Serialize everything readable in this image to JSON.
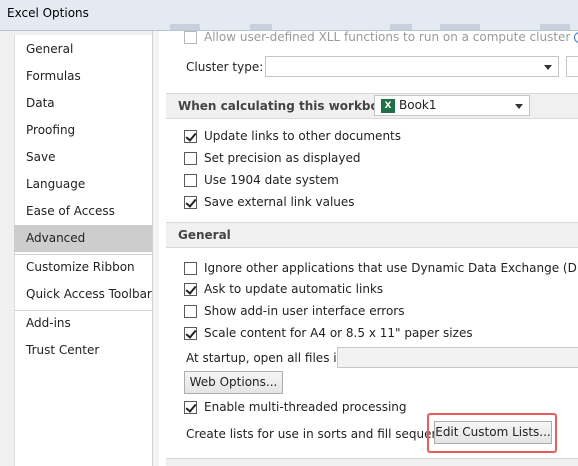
{
  "window": {
    "title": "Excel Options"
  },
  "nav": {
    "items": [
      {
        "label": "General"
      },
      {
        "label": "Formulas"
      },
      {
        "label": "Data"
      },
      {
        "label": "Proofing"
      },
      {
        "label": "Save"
      },
      {
        "label": "Language"
      },
      {
        "label": "Ease of Access"
      },
      {
        "label": "Advanced"
      },
      {
        "label": "Customize Ribbon"
      },
      {
        "label": "Quick Access Toolbar"
      },
      {
        "label": "Add-ins"
      },
      {
        "label": "Trust Center"
      }
    ],
    "selected": "Advanced"
  },
  "top": {
    "allow_xll_label": "Allow user-defined XLL functions to run on a compute cluster",
    "cluster_type_label": "Cluster type:",
    "cluster_type_value": ""
  },
  "workbook_section": {
    "header": "When calculating this workbook:",
    "workbook_value": "Book1",
    "options": [
      {
        "label": "Update links to other documents",
        "checked": true
      },
      {
        "label": "Set precision as displayed",
        "checked": false
      },
      {
        "label": "Use 1904 date system",
        "checked": false
      },
      {
        "label": "Save external link values",
        "checked": true
      }
    ]
  },
  "general_section": {
    "header": "General",
    "options": [
      {
        "label": "Ignore other applications that use Dynamic Data Exchange (DDE)",
        "checked": false
      },
      {
        "label": "Ask to update automatic links",
        "checked": true
      },
      {
        "label": "Show add-in user interface errors",
        "checked": false
      },
      {
        "label": "Scale content for A4 or 8.5 x 11\" paper sizes",
        "checked": true
      }
    ],
    "startup_label": "At startup, open all files in:",
    "startup_value": "",
    "web_options_button": "Web Options...",
    "multithread_label": "Enable multi-threaded processing",
    "multithread_checked": true,
    "custom_lists_label": "Create lists for use in sorts and fill sequences:",
    "custom_lists_button": "Edit Custom Lists..."
  },
  "colors": {
    "highlight": "#e85c5c",
    "nav_selected": "#cdcdcd",
    "excel_green": "#1e7145"
  }
}
